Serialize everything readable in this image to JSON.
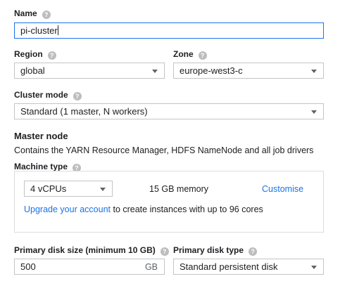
{
  "name": {
    "label": "Name",
    "value": "pi-cluster"
  },
  "region": {
    "label": "Region",
    "value": "global"
  },
  "zone": {
    "label": "Zone",
    "value": "europe-west3-c"
  },
  "cluster_mode": {
    "label": "Cluster mode",
    "value": "Standard (1 master, N workers)"
  },
  "master_node": {
    "title": "Master node",
    "description": "Contains the YARN Resource Manager, HDFS NameNode and all job drivers"
  },
  "machine_type": {
    "label": "Machine type",
    "cpu_value": "4 vCPUs",
    "memory": "15 GB memory",
    "customise": "Customise",
    "upgrade_link": "Upgrade your account",
    "upgrade_text": " to create instances with up to 96 cores"
  },
  "disk_size": {
    "label": "Primary disk size (minimum 10 GB)",
    "value": "500",
    "unit": "GB"
  },
  "disk_type": {
    "label": "Primary disk type",
    "value": "Standard persistent disk"
  },
  "help_glyph": "?"
}
